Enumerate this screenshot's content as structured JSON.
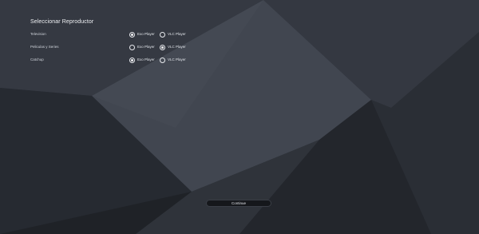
{
  "title": "Seleccionar Reproductor",
  "rows": [
    {
      "label": "Television",
      "options": [
        {
          "label": "Exo Player",
          "checked": true
        },
        {
          "label": "VLC Player",
          "checked": false
        }
      ]
    },
    {
      "label": "Peliculas y Series",
      "options": [
        {
          "label": "Exo Player",
          "checked": false
        },
        {
          "label": "VLC Player",
          "checked": true
        }
      ]
    },
    {
      "label": "Catchup",
      "options": [
        {
          "label": "Exo Player",
          "checked": true
        },
        {
          "label": "VLC Player",
          "checked": false
        }
      ]
    }
  ],
  "continue_label": "Continue",
  "colors": {
    "background": "#2c3038",
    "button": "#15171b",
    "text": "#e6e8ec"
  }
}
